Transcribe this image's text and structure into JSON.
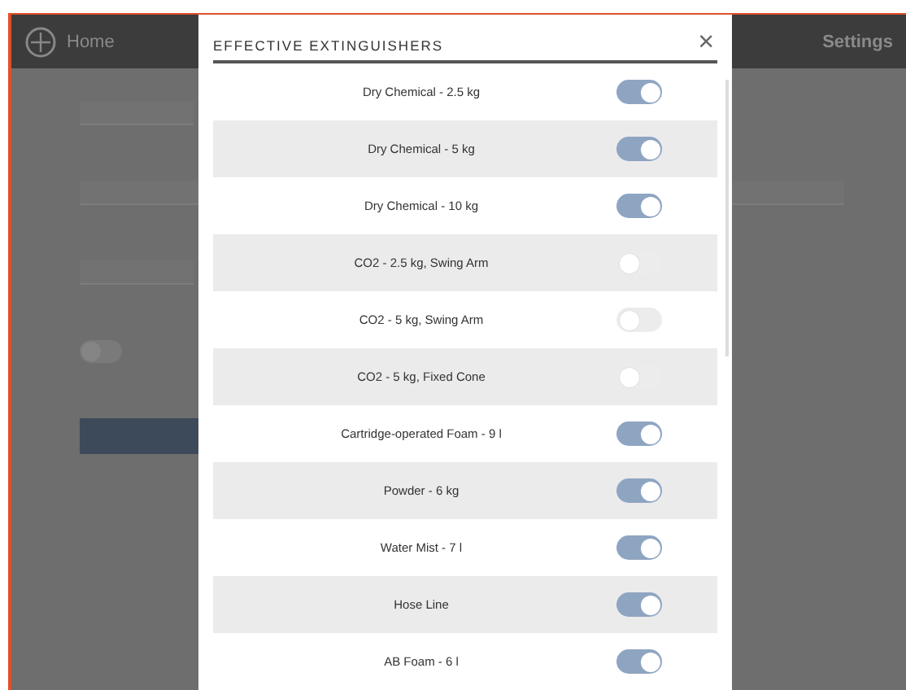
{
  "app_bar": {
    "breadcrumb": "Home",
    "settings_label": "Settings"
  },
  "background": {
    "toggle_on": false
  },
  "dialog": {
    "title": "EFFECTIVE EXTINGUISHERS",
    "close": "×",
    "items": [
      {
        "label": "Dry Chemical - 2.5 kg",
        "on": true
      },
      {
        "label": "Dry Chemical - 5 kg",
        "on": true
      },
      {
        "label": "Dry Chemical - 10 kg",
        "on": true
      },
      {
        "label": "CO2 - 2.5 kg, Swing Arm",
        "on": false
      },
      {
        "label": "CO2 - 5 kg, Swing Arm",
        "on": false
      },
      {
        "label": "CO2 - 5 kg, Fixed Cone",
        "on": false
      },
      {
        "label": "Cartridge-operated Foam - 9 l",
        "on": true
      },
      {
        "label": "Powder - 6 kg",
        "on": true
      },
      {
        "label": "Water Mist - 7 l",
        "on": true
      },
      {
        "label": "Hose Line",
        "on": true
      },
      {
        "label": "AB Foam - 6 l",
        "on": true
      }
    ]
  }
}
